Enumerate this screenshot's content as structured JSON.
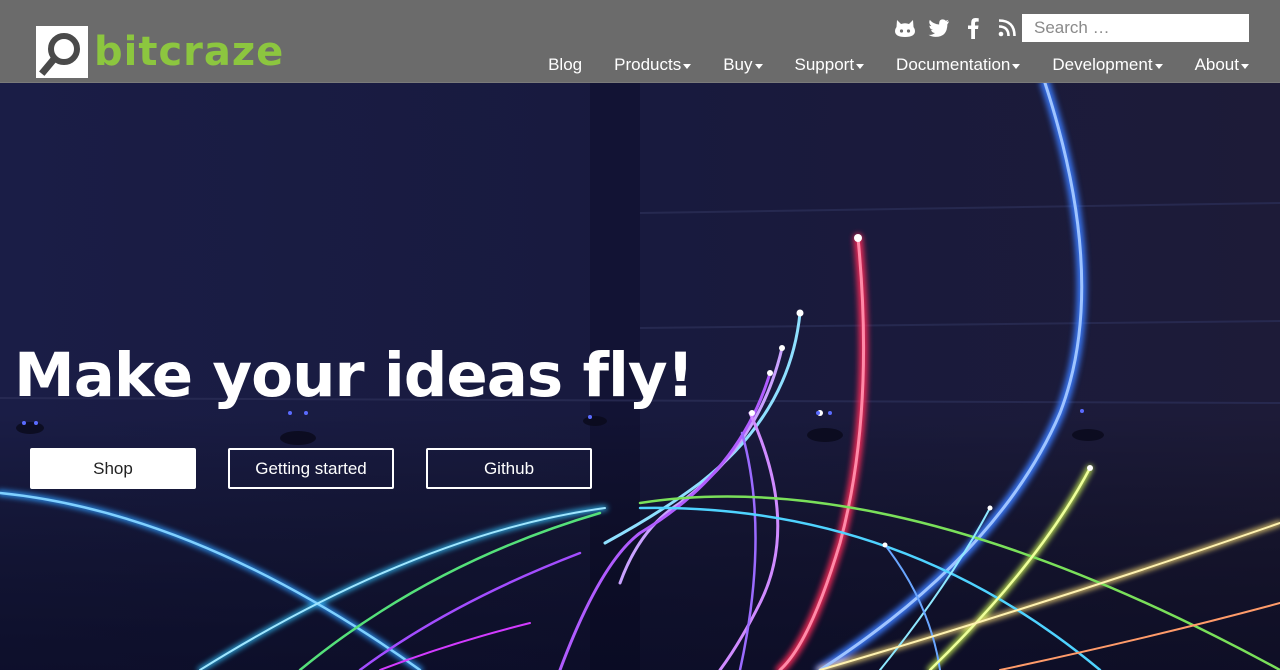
{
  "brand": {
    "name": "bitcraze",
    "color": "#8cc63f"
  },
  "social": [
    {
      "name": "github-icon"
    },
    {
      "name": "twitter-icon"
    },
    {
      "name": "facebook-icon"
    },
    {
      "name": "rss-icon"
    }
  ],
  "search": {
    "placeholder": "Search …"
  },
  "nav": {
    "items": [
      {
        "label": "Blog",
        "dropdown": false
      },
      {
        "label": "Products",
        "dropdown": true
      },
      {
        "label": "Buy",
        "dropdown": true
      },
      {
        "label": "Support",
        "dropdown": true
      },
      {
        "label": "Documentation",
        "dropdown": true
      },
      {
        "label": "Development",
        "dropdown": true
      },
      {
        "label": "About",
        "dropdown": true
      }
    ]
  },
  "hero": {
    "headline": "Make your ideas fly!",
    "buttons": {
      "shop": "Shop",
      "getting_started": "Getting started",
      "github": "Github"
    }
  },
  "colors": {
    "header_bg": "#6b6b6b",
    "accent": "#8cc63f"
  }
}
